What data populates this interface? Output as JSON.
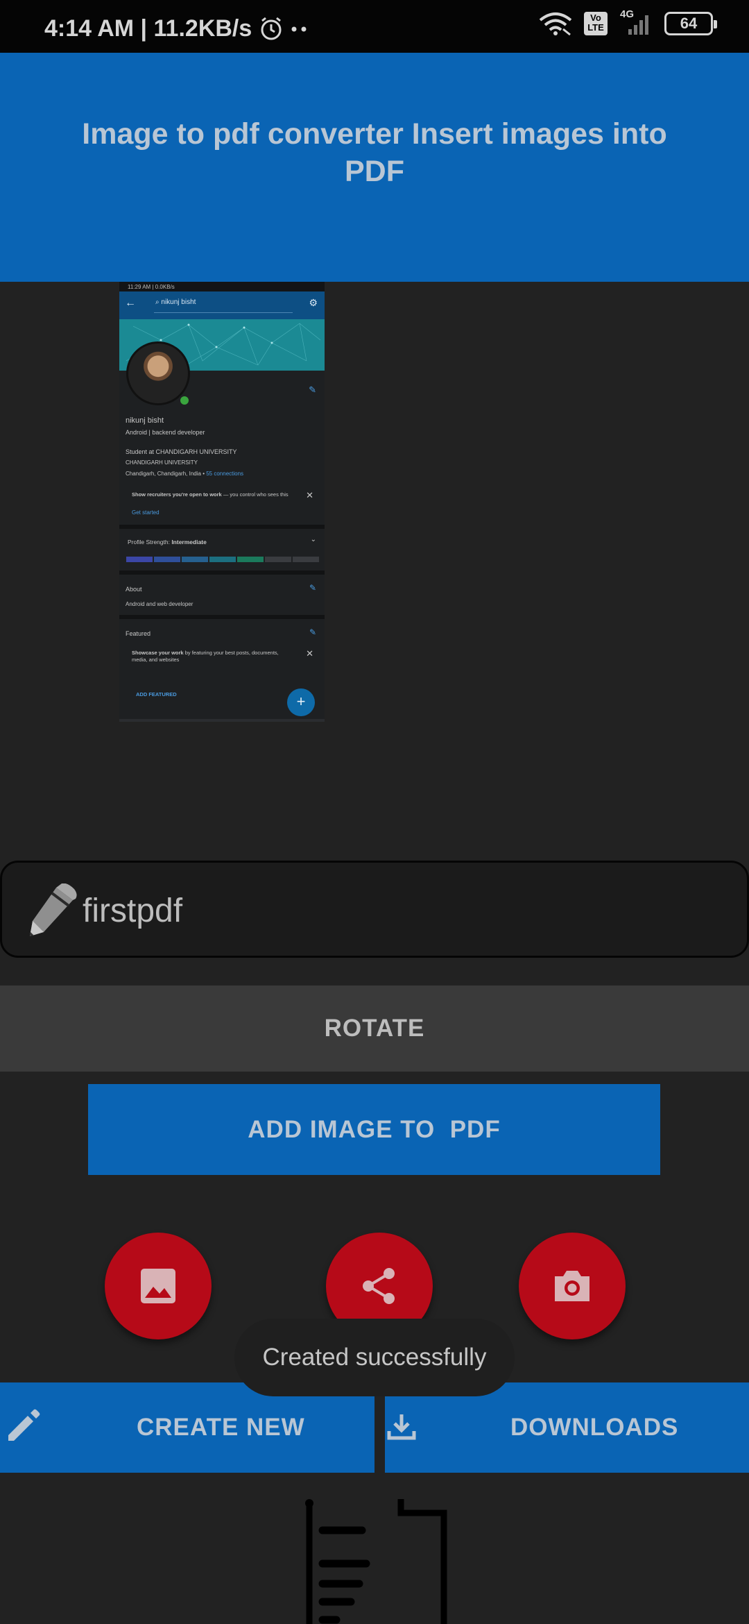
{
  "status_bar": {
    "time_speed": "4:14 AM | 11.2KB/s",
    "network": "4G",
    "volte": "Vo\nLTE",
    "battery": "64"
  },
  "header": {
    "title": "Image to pdf converter Insert images into PDF"
  },
  "preview": {
    "status": "11:29 AM | 0.0KB/s",
    "search_text": "nikunj bisht",
    "name": "nikunj bisht",
    "headline": "Android | backend developer",
    "education": "Student at CHANDIGARH UNIVERSITY",
    "school": "CHANDIGARH UNIVERSITY",
    "location": "Chandigarh, Chandigarh, India",
    "connections": "55 connections",
    "open_to_work_bold": "Show recruiters you're open to work",
    "open_to_work_rest": " — you control who sees this",
    "get_started": "Get started",
    "strength_label": "Profile Strength: ",
    "strength_value": "Intermediate",
    "about_title": "About",
    "about_text": "Android and web developer",
    "featured_title": "Featured",
    "showcase_bold": "Showcase your work",
    "showcase_rest": " by featuring your best posts, documents, media, and websites",
    "add_featured": "ADD FEATURED"
  },
  "file_name": {
    "value": "firstpdf"
  },
  "buttons": {
    "rotate": "ROTATE",
    "add_image": "ADD IMAGE TO  PDF",
    "create_new": "CREATE NEW",
    "downloads": "DOWNLOADS"
  },
  "fabs": [
    {
      "icon": "image-icon"
    },
    {
      "icon": "share-icon"
    },
    {
      "icon": "camera-icon"
    }
  ],
  "toast": {
    "message": "Created successfully"
  },
  "colors": {
    "primary_blue": "#0a64b4",
    "fab_red": "#b60a18",
    "background": "#222222"
  }
}
